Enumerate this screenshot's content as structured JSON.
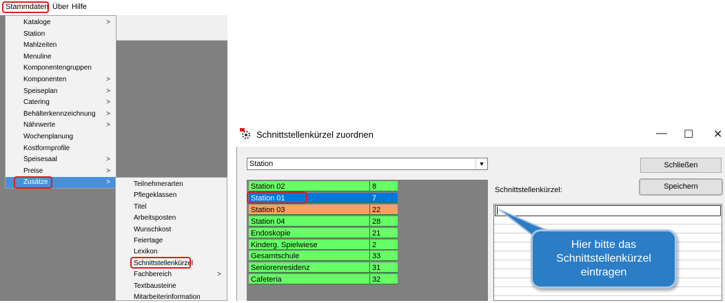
{
  "menubar": {
    "items": [
      {
        "label": "Stammdaten"
      },
      {
        "label": "Über"
      },
      {
        "label": "Hilfe"
      }
    ]
  },
  "stammdaten_menu": {
    "items": [
      {
        "label": "Kataloge",
        "submenu": true
      },
      {
        "label": "Station",
        "submenu": false
      },
      {
        "label": "Mahlzeiten",
        "submenu": false
      },
      {
        "label": "Menuline",
        "submenu": false
      },
      {
        "label": "Komponentengruppen",
        "submenu": false
      },
      {
        "label": "Komponenten",
        "submenu": true
      },
      {
        "label": "Speiseplan",
        "submenu": true
      },
      {
        "label": "Catering",
        "submenu": true
      },
      {
        "label": "Behälterkennzeichnung",
        "submenu": true
      },
      {
        "label": "Nährwerte",
        "submenu": true
      },
      {
        "label": "Wochenplanung",
        "submenu": false
      },
      {
        "label": "Kostformprofile",
        "submenu": false
      },
      {
        "label": "Speisesaal",
        "submenu": true
      },
      {
        "label": "Preise",
        "submenu": true
      },
      {
        "label": "Zusätze",
        "submenu": true,
        "highlighted": true
      }
    ]
  },
  "zusaetze_menu": {
    "items": [
      {
        "label": "Teilnehmerarten"
      },
      {
        "label": "Pflegeklassen"
      },
      {
        "label": "Titel"
      },
      {
        "label": "Arbeitsposten"
      },
      {
        "label": "Wunschkost"
      },
      {
        "label": "Feiertage"
      },
      {
        "label": "Lexikon"
      },
      {
        "label": "Schnittstellenkürzel"
      },
      {
        "label": "Fachbereich",
        "submenu": true
      },
      {
        "label": "Textbausteine"
      },
      {
        "label": "Mitarbeiterinformation"
      }
    ]
  },
  "arrow_glyph": ">",
  "dialog": {
    "title": "Schnittstellenkürzel zuordnen",
    "icon": "app-gear-icon",
    "minimize": "—",
    "maximize": "☐",
    "close": "✕",
    "combo_value": "Station",
    "combo_arrow": "▼",
    "close_button": "Schließen",
    "save_button": "Speichern",
    "field_label": "Schnittstellenkürzel:",
    "field_value": "",
    "callout_text": "Hier bitte das Schnittstellenkürzel eintragen",
    "rows": [
      {
        "name": "Station 02",
        "code": "8",
        "color": "#66ff66"
      },
      {
        "name": "Station 01",
        "code": "7",
        "color": "#0078d7",
        "selected": true
      },
      {
        "name": "Station 03",
        "code": "22",
        "color": "#f4a460"
      },
      {
        "name": "Station 04",
        "code": "28",
        "color": "#66ff66"
      },
      {
        "name": "Endoskopie",
        "code": "21",
        "color": "#66ff66"
      },
      {
        "name": "Kinderg. Spielwiese",
        "code": "2",
        "color": "#66ff66"
      },
      {
        "name": "Gesamtschule",
        "code": "33",
        "color": "#66ff66"
      },
      {
        "name": "Seniorenresidenz",
        "code": "31",
        "color": "#66ff66"
      },
      {
        "name": "Cafeteria",
        "code": "32",
        "color": "#66ff66"
      }
    ]
  },
  "colors": {
    "highlight_outline": "#e21c1c",
    "menu_highlight": "#4a90d9",
    "callout": "#2b7dc5"
  }
}
